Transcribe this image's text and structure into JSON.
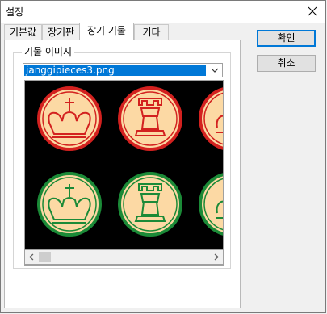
{
  "window": {
    "title": "설정"
  },
  "tabs": [
    {
      "label": "기본값"
    },
    {
      "label": "장기판"
    },
    {
      "label": "장기 기물"
    },
    {
      "label": "기타"
    }
  ],
  "active_tab": "장기 기물",
  "group": {
    "label": "기물 이미지",
    "file_select": {
      "value": "janggipieces3.png"
    }
  },
  "buttons": {
    "ok": "확인",
    "cancel": "취소"
  },
  "piece_colors": {
    "red_piece_stroke": "#d3211f",
    "green_piece_stroke": "#1b8a37",
    "piece_fill": "#fcd9a4",
    "background": "#000000"
  },
  "preview_pieces": [
    {
      "side": "red",
      "icon": "king-icon"
    },
    {
      "side": "red",
      "icon": "rook-icon"
    },
    {
      "side": "red",
      "icon": "piece-partial-icon"
    },
    {
      "side": "green",
      "icon": "king-icon"
    },
    {
      "side": "green",
      "icon": "rook-icon"
    },
    {
      "side": "green",
      "icon": "piece-partial-icon"
    }
  ]
}
